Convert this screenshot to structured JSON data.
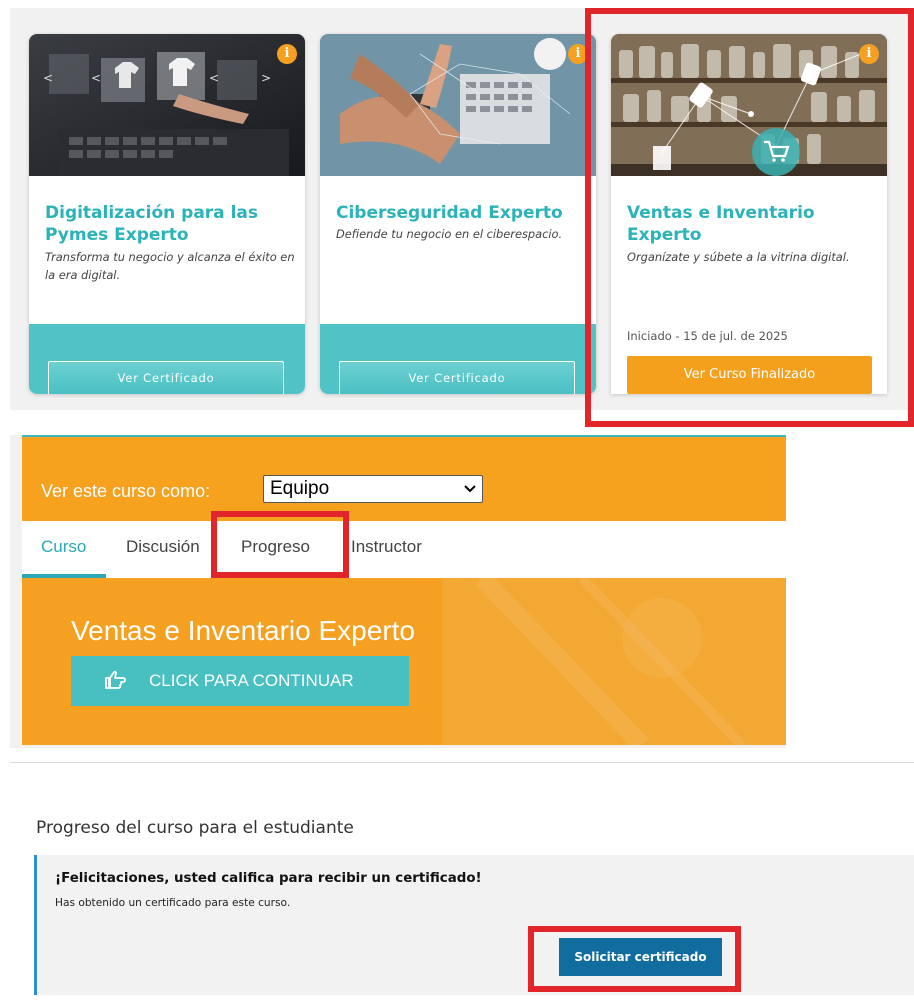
{
  "cards": [
    {
      "title": "Digitalización para las Pymes Experto",
      "subtitle": "Transforma tu negocio y alcanza el éxito en la era digital.",
      "button": "Ver Certificado",
      "info_icon": "i"
    },
    {
      "title": "Ciberseguridad Experto",
      "subtitle": "Defiende tu negocio en el ciberespacio.",
      "button": "Ver Certificado",
      "info_icon": "i"
    },
    {
      "title": "Ventas e Inventario Experto",
      "subtitle": "Organízate y súbete a la vitrina digital.",
      "status": "Iniciado - 15 de jul. de 2025",
      "button": "Ver Curso Finalizado",
      "info_icon": "i"
    }
  ],
  "course_header": {
    "view_as_label": "Ver este curso como:",
    "view_as_selected": "Equipo",
    "tabs": [
      {
        "label": "Curso",
        "active": true
      },
      {
        "label": "Discusión",
        "active": false
      },
      {
        "label": "Progreso",
        "active": false
      },
      {
        "label": "Instructor",
        "active": false
      }
    ],
    "hero_title": "Ventas e Inventario Experto",
    "continue_button": "CLICK PARA CONTINUAR"
  },
  "progress": {
    "title": "Progreso del curso para el estudiante",
    "cert_title": "¡Felicitaciones, usted califica para recibir un certificado!",
    "cert_text": "Has obtenido un certificado para este curso.",
    "request_button": "Solicitar certificado"
  },
  "colors": {
    "accent_teal": "#4fc3c6",
    "accent_orange": "#f5a021",
    "highlight_red": "#e2242b",
    "button_blue": "#126d9f"
  }
}
